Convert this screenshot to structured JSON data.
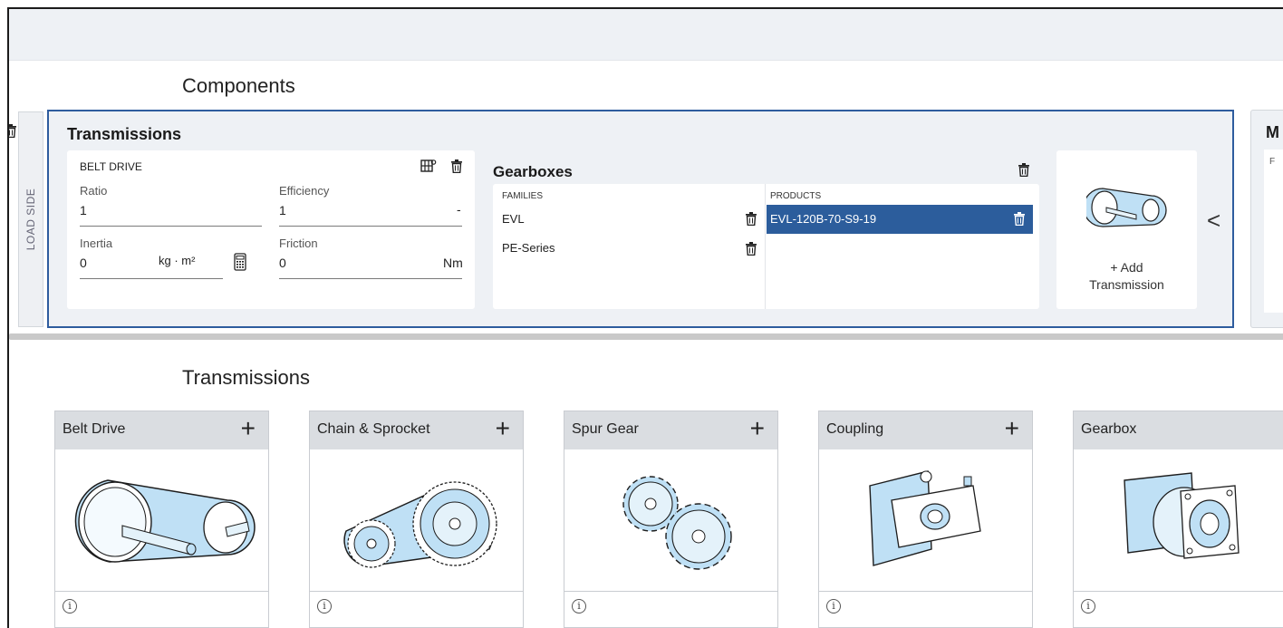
{
  "components": {
    "section_title": "Components",
    "load_side_label": "LOAD SIDE",
    "transmissions_title": "Transmissions",
    "belt_drive": {
      "title": "BELT DRIVE",
      "ratio_label": "Ratio",
      "ratio_value": "1",
      "efficiency_label": "Efficiency",
      "efficiency_value": "1",
      "efficiency_unit": "-",
      "inertia_label": "Inertia",
      "inertia_value": "0",
      "inertia_unit": "kg · m²",
      "friction_label": "Friction",
      "friction_value": "0",
      "friction_unit": "Nm"
    },
    "gearboxes": {
      "title": "Gearboxes",
      "families_header": "FAMILIES",
      "products_header": "PRODUCTS",
      "families": [
        "EVL",
        "PE-Series"
      ],
      "products": [
        "EVL-120B-70-S9-19"
      ]
    },
    "add_transmission_label": "+ Add\nTransmission",
    "right_panel_title": "M",
    "right_panel_sub": "F"
  },
  "catalog": {
    "section_title": "Transmissions",
    "tiles": [
      {
        "name": "Belt Drive",
        "plus": "+"
      },
      {
        "name": "Chain & Sprocket",
        "plus": "+"
      },
      {
        "name": "Spur Gear",
        "plus": "+"
      },
      {
        "name": "Coupling",
        "plus": "+"
      },
      {
        "name": "Gearbox",
        "plus": ""
      }
    ],
    "info_glyph": "i"
  },
  "colors": {
    "accent_blue": "#2e5c9e",
    "selected_row": "#2c5d9c",
    "part_fill": "#bfe0f5"
  }
}
